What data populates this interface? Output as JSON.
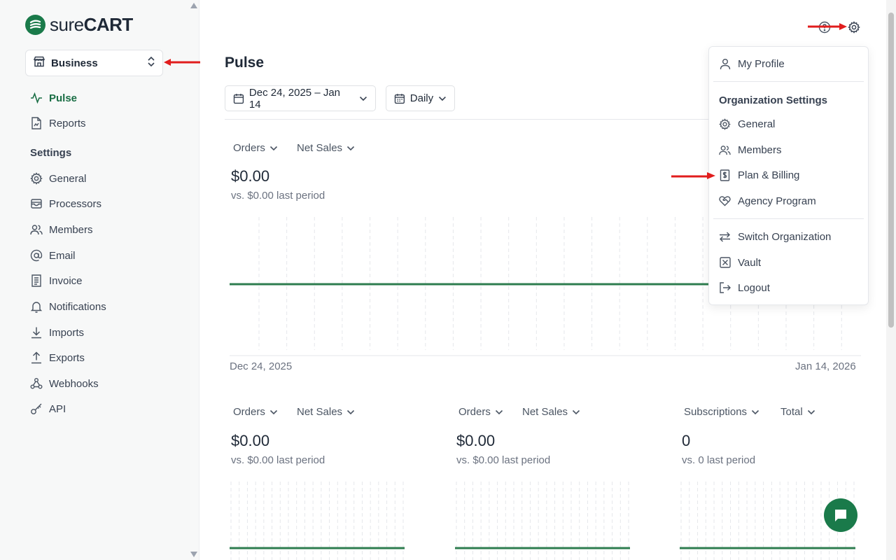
{
  "brand": {
    "name_light": "sure",
    "name_bold": "CART",
    "color": "#1a7a4a"
  },
  "store": {
    "label": "Business"
  },
  "nav": {
    "main": [
      {
        "label": "Pulse",
        "icon": "activity-icon",
        "active": true
      },
      {
        "label": "Reports",
        "icon": "report-icon",
        "active": false
      }
    ],
    "settings_title": "Settings",
    "settings": [
      {
        "label": "General",
        "icon": "gear-icon"
      },
      {
        "label": "Processors",
        "icon": "wallet-icon"
      },
      {
        "label": "Members",
        "icon": "users-icon"
      },
      {
        "label": "Email",
        "icon": "at-icon"
      },
      {
        "label": "Invoice",
        "icon": "invoice-icon"
      },
      {
        "label": "Notifications",
        "icon": "bell-icon"
      },
      {
        "label": "Imports",
        "icon": "download-icon"
      },
      {
        "label": "Exports",
        "icon": "upload-icon"
      },
      {
        "label": "Webhooks",
        "icon": "webhook-icon"
      },
      {
        "label": "API",
        "icon": "key-icon"
      }
    ]
  },
  "page": {
    "title": "Pulse",
    "date_range": "Dec 24, 2025 – Jan 14",
    "interval": "Daily"
  },
  "main_chart": {
    "metric": "Orders",
    "measure": "Net Sales",
    "value": "$0.00",
    "compare": "vs. $0.00 last period",
    "x_start": "Dec 24, 2025",
    "x_end": "Jan 14, 2026"
  },
  "cards": [
    {
      "metric": "Orders",
      "measure": "Net Sales",
      "value": "$0.00",
      "compare": "vs. $0.00 last period"
    },
    {
      "metric": "Orders",
      "measure": "Net Sales",
      "value": "$0.00",
      "compare": "vs. $0.00 last period"
    },
    {
      "metric": "Subscriptions",
      "measure": "Total",
      "value": "0",
      "compare": "vs. 0 last period"
    }
  ],
  "menu": {
    "profile": "My Profile",
    "org_heading": "Organization Settings",
    "org_items": [
      {
        "label": "General",
        "icon": "gear-icon"
      },
      {
        "label": "Members",
        "icon": "users-icon"
      },
      {
        "label": "Plan & Billing",
        "icon": "billing-icon"
      },
      {
        "label": "Agency Program",
        "icon": "heart-handshake-icon"
      }
    ],
    "account_items": [
      {
        "label": "Switch Organization",
        "icon": "switch-icon"
      },
      {
        "label": "Vault",
        "icon": "vault-icon"
      },
      {
        "label": "Logout",
        "icon": "logout-icon"
      }
    ]
  },
  "annotations": {
    "arrow_color": "#e11d1d"
  }
}
